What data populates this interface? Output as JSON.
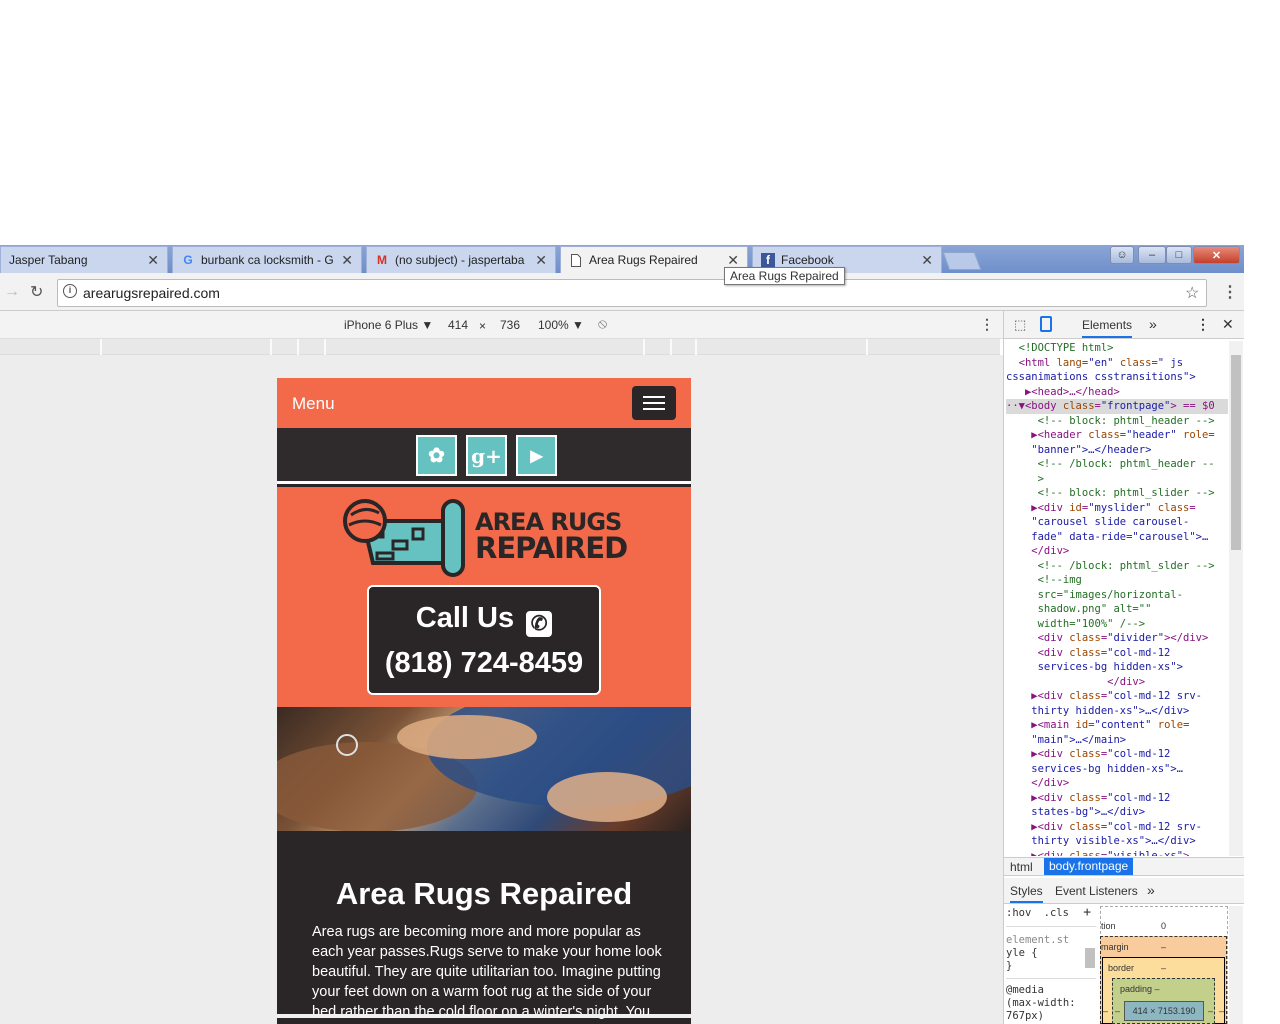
{
  "browser": {
    "tabs": [
      {
        "title": "Jasper Tabang",
        "favicon": "none",
        "active": false
      },
      {
        "title": "burbank ca locksmith - G",
        "favicon": "google-icon",
        "active": false
      },
      {
        "title": "(no subject) - jaspertaba",
        "favicon": "gmail-icon",
        "active": false
      },
      {
        "title": "Area Rugs Repaired",
        "favicon": "page-icon",
        "active": true
      },
      {
        "title": "Facebook",
        "favicon": "facebook-icon",
        "active": false
      }
    ],
    "tooltip": "Area Rugs Repaired",
    "url": "arearugsrepaired.com",
    "window_buttons": {
      "user": "☺",
      "minimize": "–",
      "maximize": "□",
      "close": "✕"
    }
  },
  "device_toolbar": {
    "device": "iPhone 6 Plus ▼",
    "width": "414",
    "times": "×",
    "height": "736",
    "zoom": "100% ▼"
  },
  "site": {
    "menu_label": "Menu",
    "social": [
      {
        "name": "yelp",
        "glyph": "✿"
      },
      {
        "name": "google-plus",
        "glyph": "g+"
      },
      {
        "name": "youtube",
        "glyph": "▶"
      }
    ],
    "logo_line1": "AREA RUGS",
    "logo_line2": "REPAIRED",
    "call_title": "Call Us",
    "call_number": "(818) 724-8459",
    "heading": "Area Rugs Repaired",
    "body": "Area rugs are becoming more and more popular as each year passes.Rugs serve to make your home look beautiful. They are quite utilitarian too. Imagine putting your feet down on a warm foot rug at the side of your bed rather than the cold floor on a winter's night. You",
    "colors": {
      "accent": "#f26a4a",
      "dark": "#2a2526",
      "teal": "#66c2c0"
    }
  },
  "devtools": {
    "panel": "Elements",
    "more": "»",
    "breadcrumb": [
      "html",
      "body.frontpage"
    ],
    "styles_tabs": [
      "Styles",
      "Event Listeners",
      "»"
    ],
    "filter": [
      ":hov",
      ".cls",
      "+"
    ],
    "styles_text": [
      "element.st",
      "yle {",
      "}",
      "@media",
      "(max-width:",
      "767px)"
    ],
    "box_model": {
      "position_label": "tion",
      "position_value": "0",
      "margin": "margin",
      "margin_value": "–",
      "border": "border",
      "border_value": "–",
      "padding": "padding –",
      "content": "414 × 7153.190",
      "side": "–"
    }
  }
}
